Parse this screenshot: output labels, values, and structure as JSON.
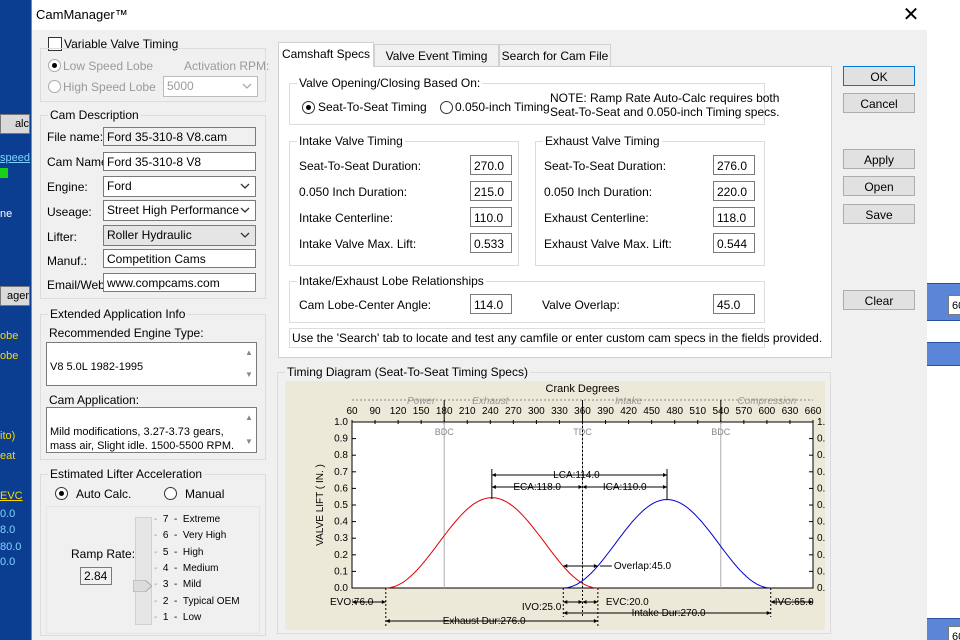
{
  "background": {
    "left_fragments": [
      "alc",
      "speed",
      "ne",
      "ager",
      "obe",
      "obe",
      "ito)",
      "eat",
      "EVC",
      "0.0",
      "8.0",
      "80.0",
      "0.0"
    ],
    "right_numbers": [
      "60",
      "60"
    ]
  },
  "window": {
    "title": "CamManager™",
    "close_label": "✕"
  },
  "vvt": {
    "checkbox_label": "Variable Valve Timing",
    "low_speed_label": "Low Speed Lobe",
    "high_speed_label": "High Speed Lobe",
    "activation_label": "Activation RPM:",
    "activation_value": "5000"
  },
  "cam_description": {
    "title": "Cam Description",
    "file_name_label": "File name:",
    "file_name_value": "Ford 35-310-8 V8.cam",
    "cam_name_label": "Cam Name:",
    "cam_name_value": "Ford 35-310-8 V8",
    "engine_label": "Engine:",
    "engine_value": "Ford",
    "useage_label": "Useage:",
    "useage_value": "Street High Performance",
    "lifter_label": "Lifter:",
    "lifter_value": "Roller Hydraulic",
    "manuf_label": "Manuf.:",
    "manuf_value": "Competition Cams",
    "email_label": "Email/Web:",
    "email_value": "www.compcams.com"
  },
  "extended_info": {
    "title": "Extended Application Info",
    "engine_type_label": "Recommended Engine Type:",
    "engine_type_value": "V8 5.0L 1982-1995",
    "application_label": "Cam Application:",
    "application_value": "Mild modifications, 3.27-3.73 gears,\nmass air, Slight idle. 1500-5500 RPM."
  },
  "lifter_accel": {
    "title": "Estimated Lifter Acceleration",
    "auto_label": "Auto Calc.",
    "manual_label": "Manual",
    "ramp_rate_label": "Ramp Rate:",
    "ramp_rate_value": "2.84",
    "levels": [
      {
        "num": "7",
        "name": "Extreme"
      },
      {
        "num": "6",
        "name": "Very High"
      },
      {
        "num": "5",
        "name": "High"
      },
      {
        "num": "4",
        "name": "Medium"
      },
      {
        "num": "3",
        "name": "Mild"
      },
      {
        "num": "2",
        "name": "Typical OEM"
      },
      {
        "num": "1",
        "name": "Low"
      }
    ],
    "selected_level": 3
  },
  "tabs": [
    {
      "label": "Camshaft Specs",
      "active": true
    },
    {
      "label": "Valve Event Timing",
      "active": false
    },
    {
      "label": "Search for Cam File",
      "active": false
    }
  ],
  "specs": {
    "basis_title": "Valve Opening/Closing Based On:",
    "seat_to_seat_label": "Seat-To-Seat Timing",
    "inch050_label": "0.050-inch Timing",
    "note": "NOTE: Ramp Rate Auto-Calc requires both\nSeat-To-Seat and 0.050-inch Timing specs.",
    "intake": {
      "title": "Intake Valve Timing",
      "rows": [
        {
          "label": "Seat-To-Seat Duration:",
          "value": "270.0"
        },
        {
          "label": "0.050 Inch Duration:",
          "value": "215.0"
        },
        {
          "label": "Intake Centerline:",
          "value": "110.0"
        },
        {
          "label": "Intake Valve Max. Lift:",
          "value": "0.533"
        }
      ]
    },
    "exhaust": {
      "title": "Exhaust Valve Timing",
      "rows": [
        {
          "label": "Seat-To-Seat Duration:",
          "value": "276.0"
        },
        {
          "label": "0.050 Inch Duration:",
          "value": "220.0"
        },
        {
          "label": "Exhaust Centerline:",
          "value": "118.0"
        },
        {
          "label": "Exhaust Valve Max. Lift:",
          "value": "0.544"
        }
      ]
    },
    "lobe": {
      "title": "Intake/Exhaust Lobe Relationships",
      "lca_label": "Cam Lobe-Center Angle:",
      "lca_value": "114.0",
      "overlap_label": "Valve Overlap:",
      "overlap_value": "45.0"
    },
    "hint": "Use the 'Search' tab to locate and test any camfile or enter custom cam specs in the fields provided."
  },
  "buttons": {
    "ok": "OK",
    "cancel": "Cancel",
    "apply": "Apply",
    "open": "Open",
    "save": "Save",
    "clear": "Clear"
  },
  "diagram": {
    "group_title": "Timing Diagram (Seat-To-Seat Timing Specs)",
    "crank_label": "Crank Degrees",
    "ylabel": "VALVE LIFT ( IN. )",
    "strokes": [
      "Power",
      "Exhaust",
      "Intake",
      "Compression"
    ],
    "markers": [
      "BDC",
      "TDC",
      "BDC"
    ],
    "lca_annot": "LCA:114.0",
    "eca_annot": "ECA:118.0",
    "ica_annot": "ICA:110.0",
    "overlap_annot": "Overlap:45.0",
    "evo_annot": "EVO:76.0",
    "ivo_annot": "IVO:25.0",
    "evc_annot": "EVC:20.0",
    "ivc_annot": "IVC:65.0",
    "intake_dur_annot": "Intake Dur:270.0",
    "exhaust_dur_annot": "Exhaust Dur:276.0",
    "bg_color": "#ece9d8",
    "exhaust_color": "#e00000",
    "intake_color": "#0000cc"
  },
  "chart_data": {
    "type": "line",
    "xlabel": "Crank Degrees",
    "ylabel": "VALVE LIFT ( IN. )",
    "xlim": [
      60,
      660
    ],
    "ylim": [
      0,
      1.0
    ],
    "x_ticks": [
      60,
      90,
      120,
      150,
      180,
      210,
      240,
      270,
      300,
      330,
      360,
      390,
      420,
      450,
      480,
      510,
      540,
      570,
      600,
      630,
      660
    ],
    "y_ticks": [
      "0.0",
      "0.1",
      "0.2",
      "0.3",
      "0.4",
      "0.5",
      "0.6",
      "0.7",
      "0.8",
      "0.9",
      "1.0"
    ],
    "series": [
      {
        "name": "Exhaust",
        "open": 104,
        "close": 380,
        "centerline": 242,
        "max_lift": 0.544
      },
      {
        "name": "Intake",
        "open": 335,
        "close": 605,
        "centerline": 470,
        "max_lift": 0.533
      }
    ]
  }
}
